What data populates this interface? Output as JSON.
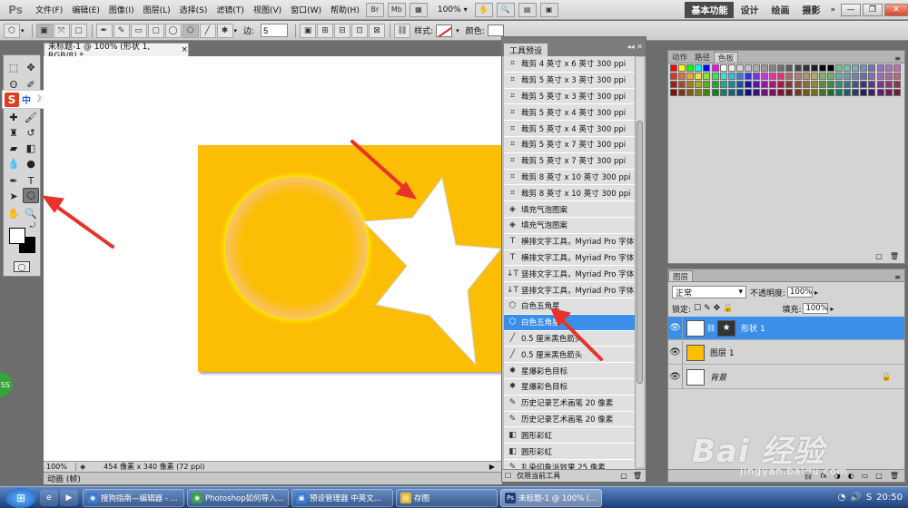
{
  "app": {
    "logo": "Ps",
    "doc_tab": "未标题-1 @ 100% (形状 1, RGB/8) *",
    "doc_tab_close": "×"
  },
  "menu": [
    "文件(F)",
    "编辑(E)",
    "图像(I)",
    "图层(L)",
    "选择(S)",
    "滤镜(T)",
    "视图(V)",
    "窗口(W)",
    "帮助(H)"
  ],
  "menubar_icons": {
    "bridge": "Br",
    "minibridge": "Mb",
    "zoom": "100%"
  },
  "workspaces": [
    "基本功能",
    "设计",
    "绘画",
    "摄影"
  ],
  "window_controls": {
    "minimize": "—",
    "restore": "❐",
    "close": "✕"
  },
  "options": {
    "sides_label": "边:",
    "sides_value": "5",
    "style_label": "样式:",
    "color_label": "颜色:"
  },
  "ime": {
    "logo": "S",
    "lang": "中"
  },
  "green_badge": "SS",
  "status": {
    "zoom": "100%",
    "info": "454 像素 x 340 像素 (72 ppi)"
  },
  "timeline_tab": "动画 (帧)",
  "preset_panel": {
    "title": "工具预设",
    "items": [
      "裁剪 4 英寸 x 6 英寸 300 ppi",
      "裁剪 5 英寸 x 3 英寸 300 ppi",
      "裁剪 5 英寸 x 3 英寸 300 ppi",
      "裁剪 5 英寸 x 4 英寸 300 ppi",
      "裁剪 5 英寸 x 4 英寸 300 ppi",
      "裁剪 5 英寸 x 7 英寸 300 ppi",
      "裁剪 5 英寸 x 7 英寸 300 ppi",
      "裁剪 8 英寸 x 10 英寸 300 ppi",
      "裁剪 8 英寸 x 10 英寸 300 ppi",
      "填充气泡图案",
      "填充气泡图案",
      "横排文字工具，Myriad Pro 字体",
      "横排文字工具，Myriad Pro 字体",
      "竖排文字工具，Myriad Pro 字体",
      "竖排文字工具，Myriad Pro 字体",
      "白色五角星",
      "白色五角星",
      "0.5 厘米黑色箭头",
      "0.5 厘米黑色箭头",
      "星爆彩色目标",
      "星爆彩色目标",
      "历史记录艺术画笔 20 像素",
      "历史记录艺术画笔 20 像素",
      "圆形彩虹",
      "圆形彩虹",
      "扎染印象派效果 25 像素"
    ],
    "selected_index": 16,
    "footer_checkbox_label": "仅限当前工具"
  },
  "swatch_panel": {
    "tabs": [
      "动作",
      "路径",
      "色板"
    ],
    "active_tab": 2
  },
  "layers_panel": {
    "title": "图层",
    "blend_mode": "正常",
    "opacity_label": "不透明度:",
    "opacity_value": "100%",
    "lock_label": "锁定:",
    "fill_label": "填充:",
    "fill_value": "100%",
    "layers": [
      {
        "name": "形状 1",
        "selected": true
      },
      {
        "name": "图层 1",
        "selected": false
      },
      {
        "name": "背景",
        "selected": false
      }
    ]
  },
  "taskbar": {
    "items": [
      "搜狗指南—编辑器 - ...",
      "Photoshop如何导入...",
      "预设管理器 中英文...",
      "存图",
      "未标题-1 @ 100% (..."
    ],
    "active_index": 4,
    "clock": "20:50"
  },
  "watermark": {
    "text": "Bai 经验",
    "url": "jingyan.baidu.com"
  },
  "colors": {
    "canvas": "#fcbd05",
    "selection": "#3b8fe8",
    "arrow": "#e8322a"
  }
}
